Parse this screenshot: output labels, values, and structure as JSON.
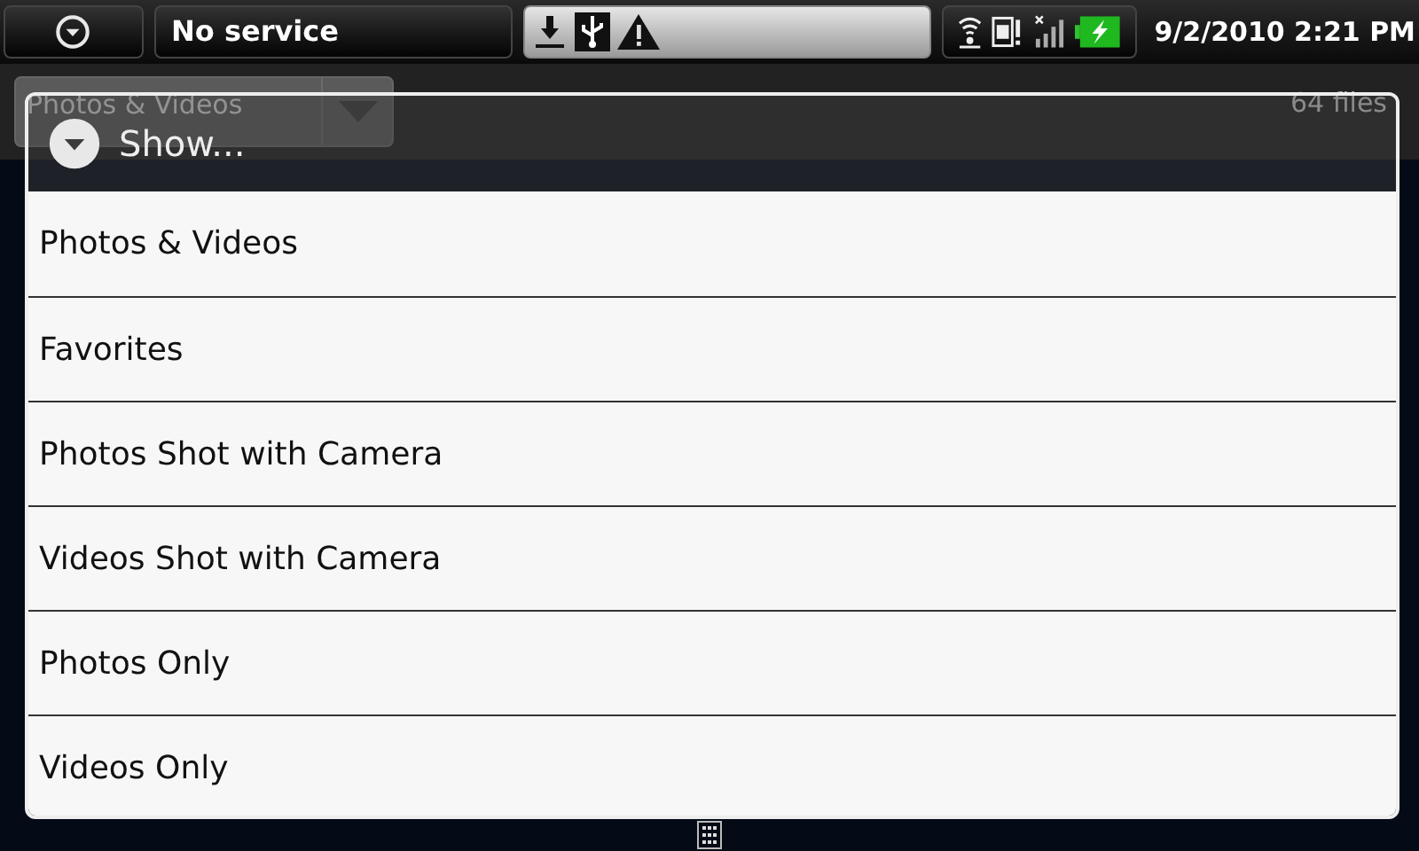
{
  "status_bar": {
    "carrier": "No service",
    "time": "9/2/2010 2:21 PM"
  },
  "background": {
    "spinner_label": "Photos & Videos",
    "file_count": "64 files"
  },
  "dialog": {
    "title": "Show...",
    "options": [
      {
        "label": "Photos & Videos"
      },
      {
        "label": "Favorites"
      },
      {
        "label": "Photos Shot with Camera"
      },
      {
        "label": "Videos Shot with Camera"
      },
      {
        "label": "Photos Only"
      },
      {
        "label": "Videos Only"
      }
    ]
  }
}
